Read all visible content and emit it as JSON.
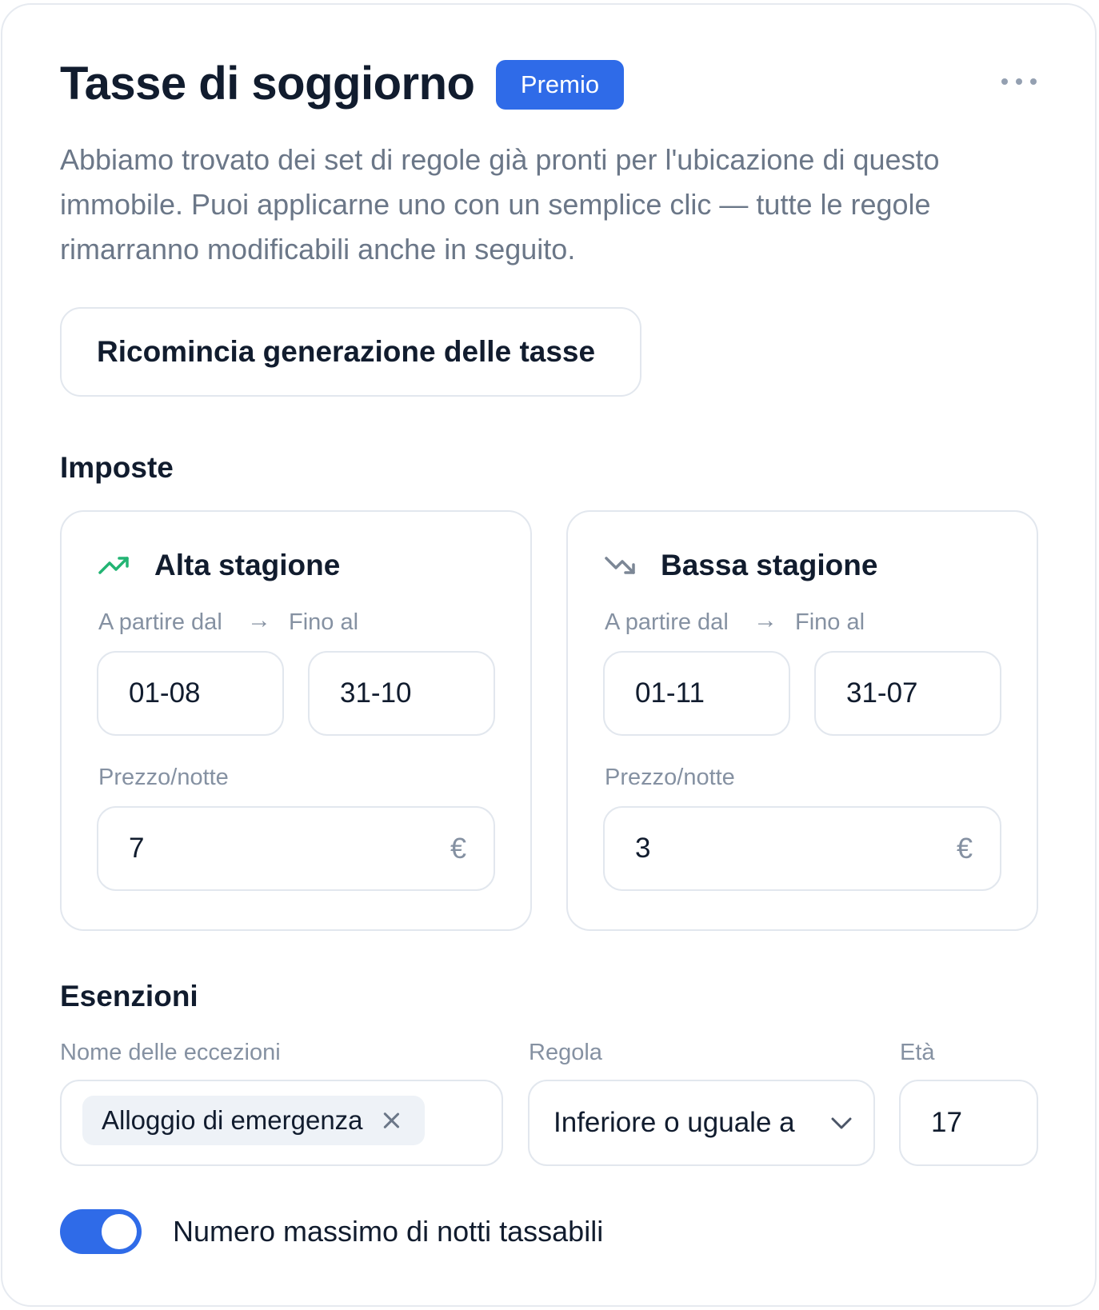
{
  "header": {
    "title": "Tasse di soggiorno",
    "badge": "Premio",
    "more_icon": "more-horizontal-icon"
  },
  "description": "Abbiamo trovato dei set di regole già pronti per l'ubicazione di questo immobile. Puoi applicarne uno con un semplice clic — tutte le regole rimarranno modificabili anche in seguito.",
  "restart_button": "Ricomincia generazione delle tasse",
  "imposte": {
    "heading": "Imposte",
    "high_season": {
      "title": "Alta stagione",
      "icon": "trending-up-icon",
      "icon_color": "#22b473",
      "from_label": "A partire dal",
      "arrow": "→",
      "to_label": "Fino al",
      "from_value": "01-08",
      "to_value": "31-10",
      "price_label": "Prezzo/notte",
      "price_value": "7",
      "currency": "€"
    },
    "low_season": {
      "title": "Bassa stagione",
      "icon": "trending-down-icon",
      "icon_color": "#7c8796",
      "from_label": "A partire dal",
      "arrow": "→",
      "to_label": "Fino al",
      "from_value": "01-11",
      "to_value": "31-07",
      "price_label": "Prezzo/notte",
      "price_value": "3",
      "currency": "€"
    }
  },
  "esenzioni": {
    "heading": "Esenzioni",
    "name_label": "Nome delle eccezioni",
    "rule_label": "Regola",
    "age_label": "Età",
    "chip": "Alloggio di emergenza",
    "rule_value": "Inferiore o uguale a",
    "age_value": "17"
  },
  "toggle": {
    "label": "Numero massimo di notti tassabili",
    "on": true
  },
  "colors": {
    "accent": "#2f6be8",
    "text": "#111c2e",
    "muted": "#8591a2",
    "border": "#e2e7ee"
  }
}
